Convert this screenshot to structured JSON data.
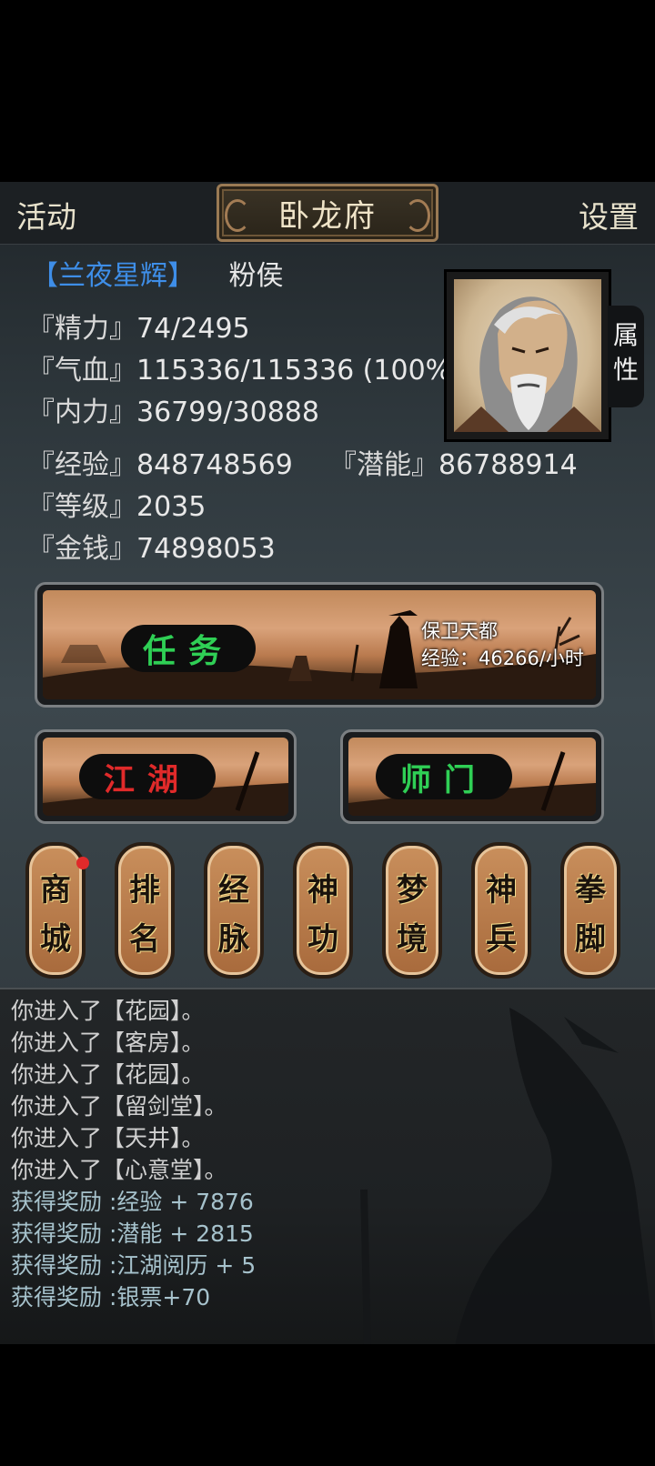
{
  "header": {
    "left": "活动",
    "title": "卧龙府",
    "right": "设置"
  },
  "player": {
    "guild": "【兰夜星辉】",
    "rank": "粉侯",
    "stats": [
      {
        "label": "『精力』",
        "value": "74/2495"
      },
      {
        "label": "『气血』",
        "value": "115336/115336 (100%"
      },
      {
        "label": "『内力』",
        "value": "36799/30888"
      }
    ],
    "exp": {
      "label": "『经验』",
      "value": "848748569"
    },
    "potential": {
      "label": "『潜能』",
      "value": "86788914"
    },
    "level": {
      "label": "『等级』",
      "value": "2035"
    },
    "money": {
      "label": "『金钱』",
      "value": "74898053"
    },
    "attr_tab": [
      "属",
      "性"
    ]
  },
  "quest": {
    "label": "任务",
    "name": "保卫天都",
    "exp_rate": "经验：46266/小时",
    "label_color": "#2fcf55"
  },
  "jianghu": {
    "label": "江湖",
    "color": "#e02a2a"
  },
  "shimen": {
    "label": "师门",
    "color": "#2fcf55"
  },
  "tabs": [
    {
      "top": "商",
      "bottom": "城",
      "badge": true
    },
    {
      "top": "排",
      "bottom": "名"
    },
    {
      "top": "经",
      "bottom": "脉"
    },
    {
      "top": "神",
      "bottom": "功"
    },
    {
      "top": "梦",
      "bottom": "境"
    },
    {
      "top": "神",
      "bottom": "兵"
    },
    {
      "top": "拳",
      "bottom": "脚"
    }
  ],
  "log": [
    "你进入了【花园】。",
    "你进入了【客房】。",
    "你进入了【花园】。",
    "你进入了【留剑堂】。",
    "你进入了【天井】。",
    "你进入了【心意堂】。",
    "获得奖励 :经验 + 7876",
    "获得奖励 :潜能 + 2815",
    "获得奖励 :江湖阅历 + 5",
    "获得奖励 :银票+70"
  ]
}
